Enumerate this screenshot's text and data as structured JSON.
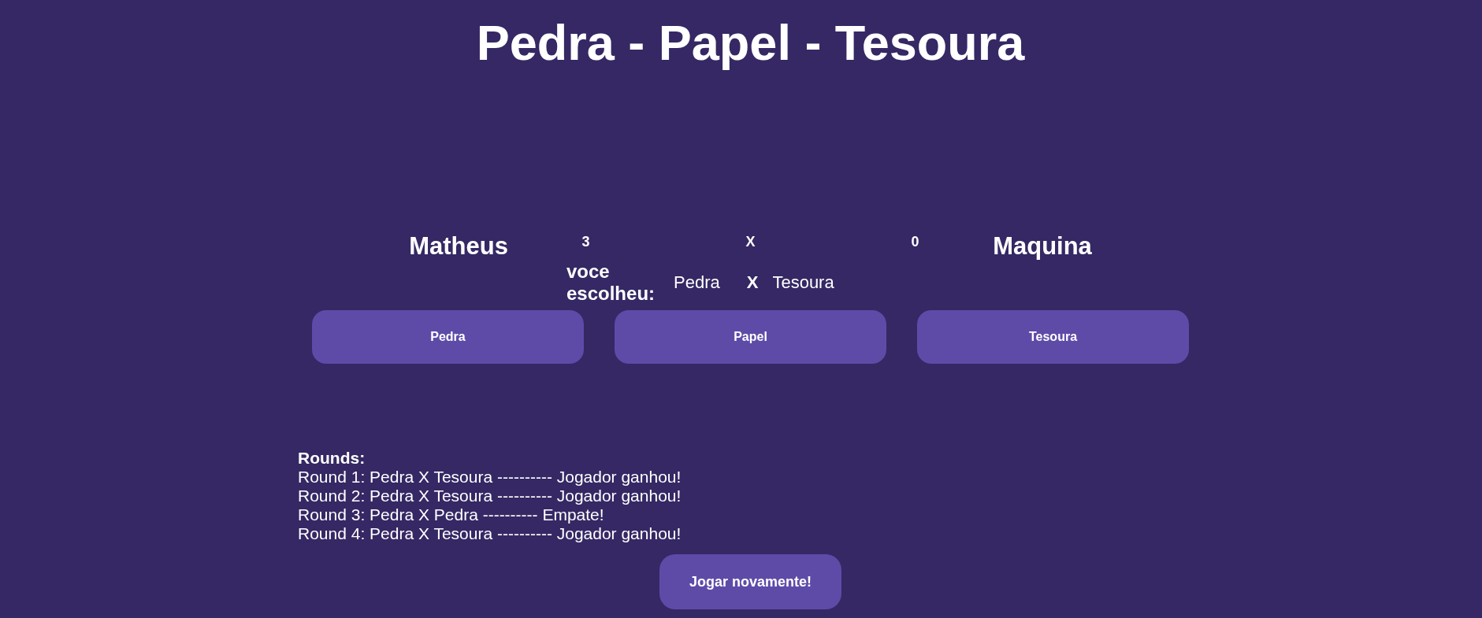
{
  "title": "Pedra - Papel - Tesoura",
  "scoreboard": {
    "player_name": "Matheus",
    "player_score": "3",
    "separator": "X",
    "machine_score": "0",
    "machine_name": "Maquina"
  },
  "last_play": {
    "label": "voce escolheu:",
    "player_choice": "Pedra",
    "separator": "X",
    "machine_choice": "Tesoura"
  },
  "choice_buttons": [
    "Pedra",
    "Papel",
    "Tesoura"
  ],
  "rounds": {
    "heading": "Rounds:",
    "entries": [
      "Round 1: Pedra X Tesoura ---------- Jogador ganhou!",
      "Round 2: Pedra X Tesoura ---------- Jogador ganhou!",
      "Round 3: Pedra X Pedra ---------- Empate!",
      "Round 4: Pedra X Tesoura ---------- Jogador ganhou!"
    ]
  },
  "play_again_button": "Jogar novamente!"
}
